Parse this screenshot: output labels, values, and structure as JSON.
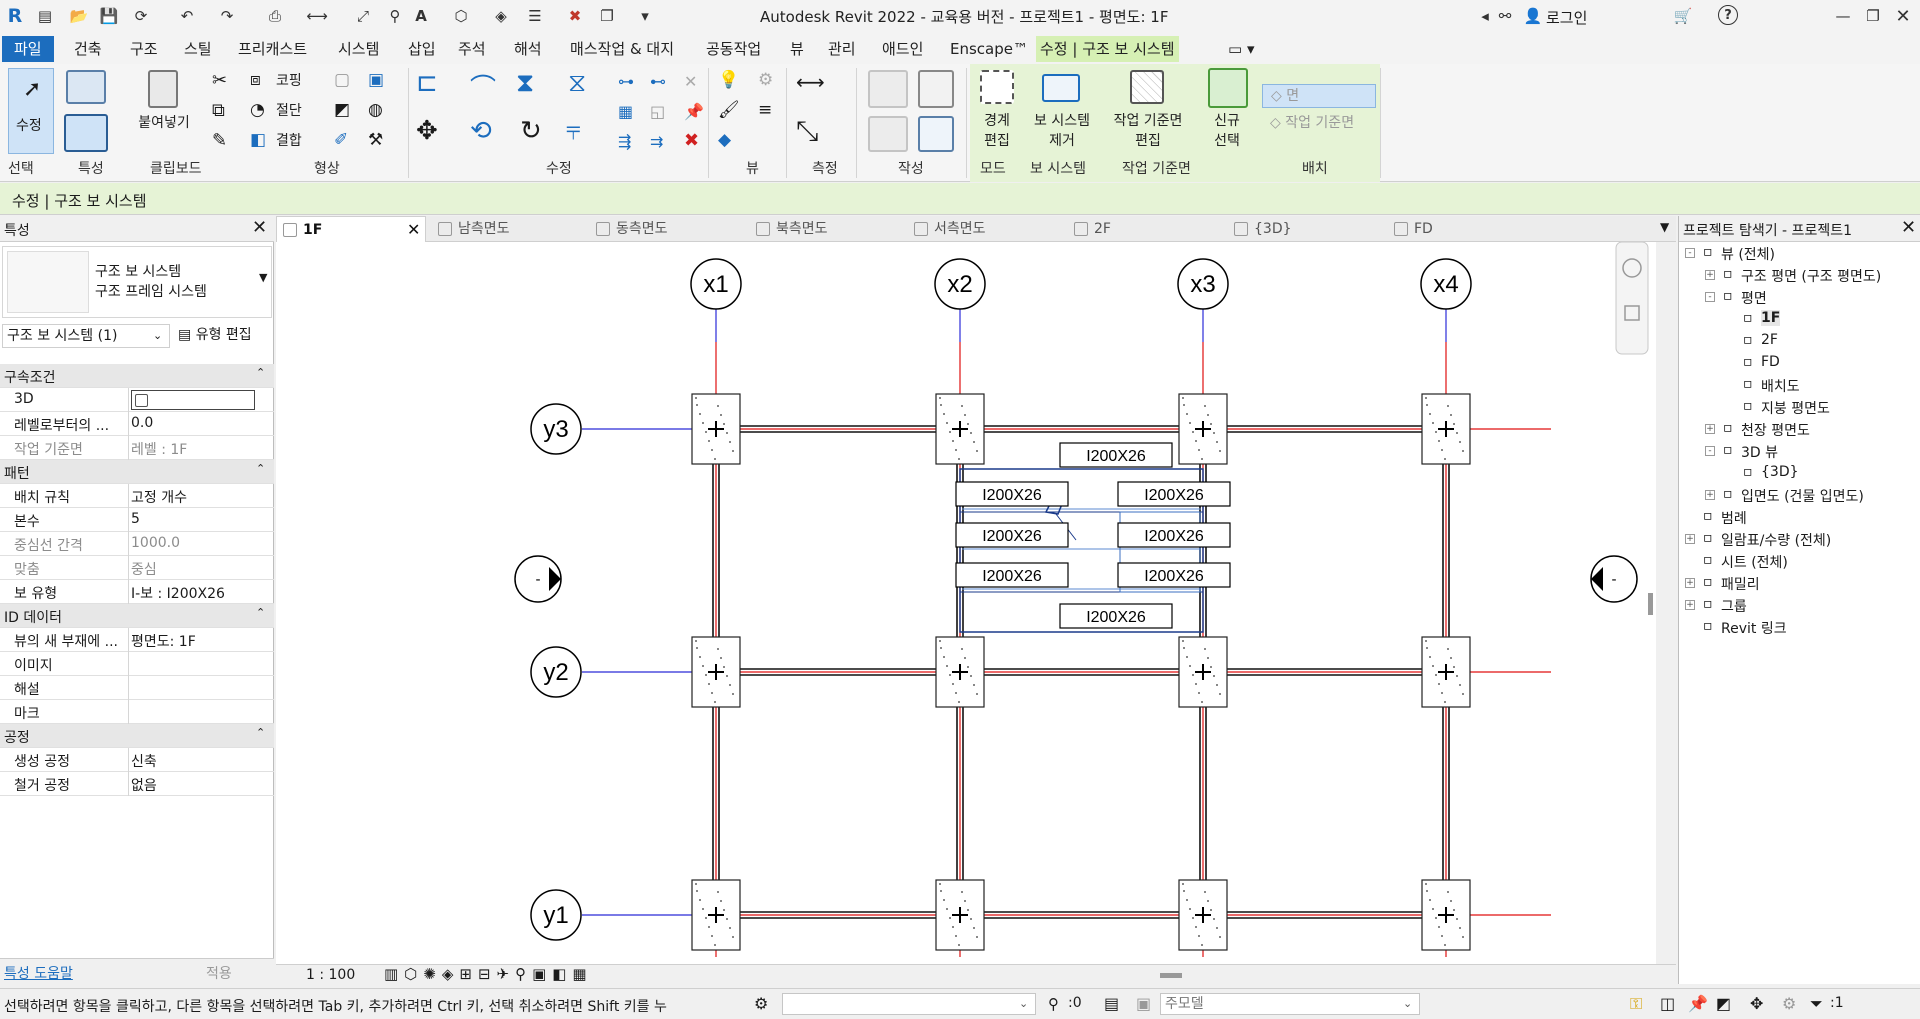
{
  "app": {
    "title": "Autodesk Revit 2022 - 교육용 버전 - 프로젝트1 - 평면도: 1F",
    "user_label": "로그인",
    "help_icon": "?"
  },
  "menu_tabs": [
    "파일",
    "건축",
    "구조",
    "스틸",
    "프리캐스트",
    "시스템",
    "삽입",
    "주석",
    "해석",
    "매스작업 & 대지",
    "공동작업",
    "뷰",
    "관리",
    "애드인",
    "Enscape™",
    "수정 | 구조 보 시스템"
  ],
  "ribbon": {
    "modify_label": "수정",
    "paste_label": "붙여넣기",
    "cope_label": "코핑",
    "cut_label": "절단",
    "join_label": "결합",
    "boundary_edit_label": [
      "경계",
      "편집"
    ],
    "remove_system_label": [
      "보 시스템",
      "제거"
    ],
    "workplane_edit_label": [
      "작업 기준면",
      "편집"
    ],
    "new_select_label": [
      "신규",
      "선택"
    ],
    "face_button_label": "면",
    "workplane_button_label": "작업 기준면",
    "panels": [
      "선택",
      "특성",
      "클립보드",
      "형상",
      "수정",
      "뷰",
      "측정",
      "작성",
      "모드",
      "보 시스템",
      "작업 기준면",
      "배치"
    ]
  },
  "context_line": "수정 | 구조 보 시스템",
  "properties": {
    "title": "특성",
    "type_line1": "구조 보 시스템",
    "type_line2": "구조 프레임 시스템",
    "selector": "구조 보 시스템 (1)",
    "edit_type": "유형 편집",
    "groups": [
      {
        "name": "구속조건",
        "rows": [
          {
            "k": "3D",
            "v": ""
          },
          {
            "k": "레벨로부터의 ...",
            "v": "0.0"
          },
          {
            "k": "작업 기준면",
            "v": "레벨 : 1F",
            "grey": true
          }
        ]
      },
      {
        "name": "패턴",
        "rows": [
          {
            "k": "배치 규칙",
            "v": "고정 개수"
          },
          {
            "k": "본수",
            "v": "5"
          },
          {
            "k": "중심선 간격",
            "v": "1000.0",
            "grey": true
          },
          {
            "k": "맞춤",
            "v": "중심",
            "grey": true
          },
          {
            "k": "보 유형",
            "v": "I-보 : I200X26"
          }
        ]
      },
      {
        "name": "ID 데이터",
        "rows": [
          {
            "k": "뷰의 새 부재에 ...",
            "v": "평면도: 1F"
          },
          {
            "k": "이미지",
            "v": ""
          },
          {
            "k": "해설",
            "v": ""
          },
          {
            "k": "마크",
            "v": ""
          }
        ]
      },
      {
        "name": "공정",
        "rows": [
          {
            "k": "생성 공정",
            "v": "신축"
          },
          {
            "k": "철거 공정",
            "v": "없음"
          }
        ]
      }
    ],
    "help_link": "특성 도움말",
    "apply": "적용"
  },
  "view_tabs": [
    "1F",
    "남측면도",
    "동측면도",
    "북측면도",
    "서측면도",
    "2F",
    "{3D}",
    "FD"
  ],
  "canvas": {
    "grid_x": [
      "x1",
      "x2",
      "x3",
      "x4"
    ],
    "grid_y": [
      "y3",
      "y2",
      "y1"
    ],
    "beam_tags": [
      "I200X26",
      "I200X26",
      "I200X26",
      "I200X26",
      "I200X26",
      "I200X26",
      "I200X26",
      "I200X26"
    ],
    "elevation_marker": "-"
  },
  "view_control": {
    "scale": "1 : 100"
  },
  "browser": {
    "title": "프로젝트 탐색기 - 프로젝트1",
    "nodes": [
      {
        "label": "뷰 (전체)",
        "level": 0,
        "exp": "-"
      },
      {
        "label": "구조 평면 (구조 평면도)",
        "level": 1,
        "exp": "+"
      },
      {
        "label": "평면",
        "level": 1,
        "exp": "-"
      },
      {
        "label": "1F",
        "level": 2,
        "bold": true
      },
      {
        "label": "2F",
        "level": 2
      },
      {
        "label": "FD",
        "level": 2
      },
      {
        "label": "배치도",
        "level": 2
      },
      {
        "label": "지붕 평면도",
        "level": 2
      },
      {
        "label": "천장 평면도",
        "level": 1,
        "exp": "+"
      },
      {
        "label": "3D 뷰",
        "level": 1,
        "exp": "-"
      },
      {
        "label": "{3D}",
        "level": 2
      },
      {
        "label": "입면도 (건물 입면도)",
        "level": 1,
        "exp": "+"
      },
      {
        "label": "범례",
        "level": 0
      },
      {
        "label": "일람표/수량 (전체)",
        "level": 0,
        "exp": "+"
      },
      {
        "label": "시트 (전체)",
        "level": 0
      },
      {
        "label": "패밀리",
        "level": 0,
        "exp": "+"
      },
      {
        "label": "그룹",
        "level": 0,
        "exp": "+"
      },
      {
        "label": "Revit 링크",
        "level": 0
      }
    ]
  },
  "status": {
    "message": "선택하려면 항목을 클릭하고, 다른 항목을 선택하려면 Tab 키, 추가하려면 Ctrl 키, 선택 취소하려면 Shift 키를 누",
    "zero": ":0",
    "model": "주모델",
    "filter": ":1"
  },
  "colors": {
    "accent": "#1c6dbe",
    "context": "#d6f0b4",
    "grid_red": "#e01010",
    "grid_blue": "#2a2ad8"
  }
}
